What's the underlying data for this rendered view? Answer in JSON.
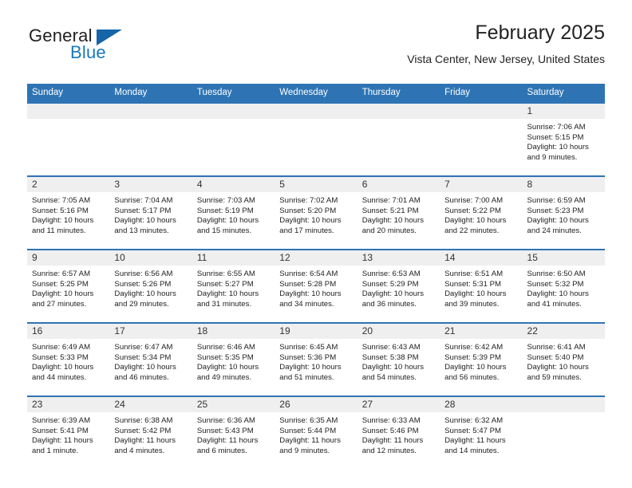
{
  "brand": {
    "name_top": "General",
    "name_bottom": "Blue",
    "triangle_icon": "triangle-icon",
    "color_dark": "#222222",
    "color_blue": "#1878BE"
  },
  "header": {
    "title": "February 2025",
    "subtitle": "Vista Center, New Jersey, United States"
  },
  "theme": {
    "header_blue": "#2E74B5",
    "daynum_band": "#EFEFEF",
    "text": "#222222"
  },
  "calendar": {
    "weekday_headers": [
      "Sunday",
      "Monday",
      "Tuesday",
      "Wednesday",
      "Thursday",
      "Friday",
      "Saturday"
    ],
    "labels": {
      "sunrise": "Sunrise:",
      "sunset": "Sunset:",
      "daylight": "Daylight:"
    },
    "weeks": [
      [
        {
          "day": "",
          "empty": true
        },
        {
          "day": "",
          "empty": true
        },
        {
          "day": "",
          "empty": true
        },
        {
          "day": "",
          "empty": true
        },
        {
          "day": "",
          "empty": true
        },
        {
          "day": "",
          "empty": true
        },
        {
          "day": "1",
          "sunrise": "Sunrise: 7:06 AM",
          "sunset": "Sunset: 5:15 PM",
          "daylight": "Daylight: 10 hours and 9 minutes."
        }
      ],
      [
        {
          "day": "2",
          "sunrise": "Sunrise: 7:05 AM",
          "sunset": "Sunset: 5:16 PM",
          "daylight": "Daylight: 10 hours and 11 minutes."
        },
        {
          "day": "3",
          "sunrise": "Sunrise: 7:04 AM",
          "sunset": "Sunset: 5:17 PM",
          "daylight": "Daylight: 10 hours and 13 minutes."
        },
        {
          "day": "4",
          "sunrise": "Sunrise: 7:03 AM",
          "sunset": "Sunset: 5:19 PM",
          "daylight": "Daylight: 10 hours and 15 minutes."
        },
        {
          "day": "5",
          "sunrise": "Sunrise: 7:02 AM",
          "sunset": "Sunset: 5:20 PM",
          "daylight": "Daylight: 10 hours and 17 minutes."
        },
        {
          "day": "6",
          "sunrise": "Sunrise: 7:01 AM",
          "sunset": "Sunset: 5:21 PM",
          "daylight": "Daylight: 10 hours and 20 minutes."
        },
        {
          "day": "7",
          "sunrise": "Sunrise: 7:00 AM",
          "sunset": "Sunset: 5:22 PM",
          "daylight": "Daylight: 10 hours and 22 minutes."
        },
        {
          "day": "8",
          "sunrise": "Sunrise: 6:59 AM",
          "sunset": "Sunset: 5:23 PM",
          "daylight": "Daylight: 10 hours and 24 minutes."
        }
      ],
      [
        {
          "day": "9",
          "sunrise": "Sunrise: 6:57 AM",
          "sunset": "Sunset: 5:25 PM",
          "daylight": "Daylight: 10 hours and 27 minutes."
        },
        {
          "day": "10",
          "sunrise": "Sunrise: 6:56 AM",
          "sunset": "Sunset: 5:26 PM",
          "daylight": "Daylight: 10 hours and 29 minutes."
        },
        {
          "day": "11",
          "sunrise": "Sunrise: 6:55 AM",
          "sunset": "Sunset: 5:27 PM",
          "daylight": "Daylight: 10 hours and 31 minutes."
        },
        {
          "day": "12",
          "sunrise": "Sunrise: 6:54 AM",
          "sunset": "Sunset: 5:28 PM",
          "daylight": "Daylight: 10 hours and 34 minutes."
        },
        {
          "day": "13",
          "sunrise": "Sunrise: 6:53 AM",
          "sunset": "Sunset: 5:29 PM",
          "daylight": "Daylight: 10 hours and 36 minutes."
        },
        {
          "day": "14",
          "sunrise": "Sunrise: 6:51 AM",
          "sunset": "Sunset: 5:31 PM",
          "daylight": "Daylight: 10 hours and 39 minutes."
        },
        {
          "day": "15",
          "sunrise": "Sunrise: 6:50 AM",
          "sunset": "Sunset: 5:32 PM",
          "daylight": "Daylight: 10 hours and 41 minutes."
        }
      ],
      [
        {
          "day": "16",
          "sunrise": "Sunrise: 6:49 AM",
          "sunset": "Sunset: 5:33 PM",
          "daylight": "Daylight: 10 hours and 44 minutes."
        },
        {
          "day": "17",
          "sunrise": "Sunrise: 6:47 AM",
          "sunset": "Sunset: 5:34 PM",
          "daylight": "Daylight: 10 hours and 46 minutes."
        },
        {
          "day": "18",
          "sunrise": "Sunrise: 6:46 AM",
          "sunset": "Sunset: 5:35 PM",
          "daylight": "Daylight: 10 hours and 49 minutes."
        },
        {
          "day": "19",
          "sunrise": "Sunrise: 6:45 AM",
          "sunset": "Sunset: 5:36 PM",
          "daylight": "Daylight: 10 hours and 51 minutes."
        },
        {
          "day": "20",
          "sunrise": "Sunrise: 6:43 AM",
          "sunset": "Sunset: 5:38 PM",
          "daylight": "Daylight: 10 hours and 54 minutes."
        },
        {
          "day": "21",
          "sunrise": "Sunrise: 6:42 AM",
          "sunset": "Sunset: 5:39 PM",
          "daylight": "Daylight: 10 hours and 56 minutes."
        },
        {
          "day": "22",
          "sunrise": "Sunrise: 6:41 AM",
          "sunset": "Sunset: 5:40 PM",
          "daylight": "Daylight: 10 hours and 59 minutes."
        }
      ],
      [
        {
          "day": "23",
          "sunrise": "Sunrise: 6:39 AM",
          "sunset": "Sunset: 5:41 PM",
          "daylight": "Daylight: 11 hours and 1 minute."
        },
        {
          "day": "24",
          "sunrise": "Sunrise: 6:38 AM",
          "sunset": "Sunset: 5:42 PM",
          "daylight": "Daylight: 11 hours and 4 minutes."
        },
        {
          "day": "25",
          "sunrise": "Sunrise: 6:36 AM",
          "sunset": "Sunset: 5:43 PM",
          "daylight": "Daylight: 11 hours and 6 minutes."
        },
        {
          "day": "26",
          "sunrise": "Sunrise: 6:35 AM",
          "sunset": "Sunset: 5:44 PM",
          "daylight": "Daylight: 11 hours and 9 minutes."
        },
        {
          "day": "27",
          "sunrise": "Sunrise: 6:33 AM",
          "sunset": "Sunset: 5:46 PM",
          "daylight": "Daylight: 11 hours and 12 minutes."
        },
        {
          "day": "28",
          "sunrise": "Sunrise: 6:32 AM",
          "sunset": "Sunset: 5:47 PM",
          "daylight": "Daylight: 11 hours and 14 minutes."
        },
        {
          "day": "",
          "empty": true
        }
      ]
    ]
  }
}
